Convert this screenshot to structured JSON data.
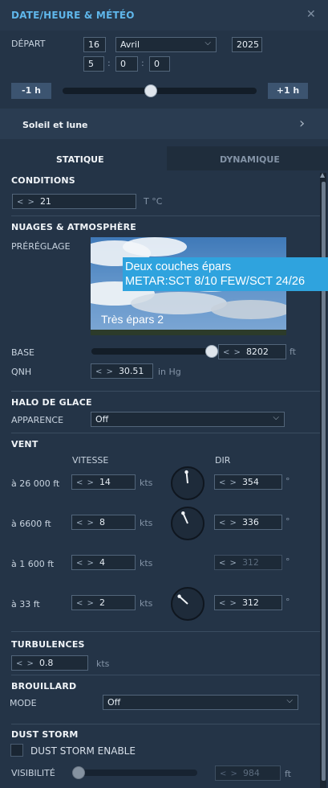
{
  "window": {
    "title": "DATE/HEURE & MÉTÉO"
  },
  "depart": {
    "label": "DÉPART",
    "day": "16",
    "month": "Avril",
    "year": "2025",
    "hour": "5",
    "minute": "0",
    "second": "0",
    "minus_hour": "-1 h",
    "plus_hour": "+1 h",
    "time_slider": 0.45
  },
  "sun_moon": {
    "label": "Soleil et lune"
  },
  "tabs": {
    "static": "STATIQUE",
    "dynamic": "DYNAMIQUE"
  },
  "conditions": {
    "title": "CONDITIONS",
    "temp": "21",
    "temp_unit": "T °C"
  },
  "clouds": {
    "title": "NUAGES & ATMOSPHÈRE",
    "preset_label": "PRÉRÉGLAGE",
    "preset_name": "Très épars 2",
    "tooltip_line1": "Deux couches épars",
    "tooltip_line2": "METAR:SCT 8/10 FEW/SCT 24/26",
    "base_label": "BASE",
    "base_value": "8202",
    "base_unit": "ft",
    "base_slider": 1.0,
    "qnh_label": "QNH",
    "qnh_value": "30.51",
    "qnh_unit": "in Hg"
  },
  "ice_halo": {
    "title": "HALO DE GLACE",
    "appearance_label": "APPARENCE",
    "appearance_value": "Off"
  },
  "wind": {
    "title": "VENT",
    "speed_header": "VITESSE",
    "dir_header": "DIR",
    "speed_unit": "kts",
    "dir_unit": "°",
    "rows": [
      {
        "alt": "à 26 000 ft",
        "speed": "14",
        "dir": "354",
        "dir_deg": 354
      },
      {
        "alt": "à 6600 ft",
        "speed": "8",
        "dir": "336",
        "dir_deg": 336
      },
      {
        "alt": "à 1 600 ft",
        "speed": "4",
        "dir": "312"
      },
      {
        "alt": "à 33 ft",
        "speed": "2",
        "dir": "312",
        "dir_deg": 312
      }
    ]
  },
  "turbulence": {
    "title": "TURBULENCES",
    "value": "0.8",
    "unit": "kts"
  },
  "fog": {
    "title": "BROUILLARD",
    "mode_label": "MODE",
    "mode_value": "Off"
  },
  "dust": {
    "title": "DUST STORM",
    "enable_label": "DUST STORM ENABLE",
    "visibility_label": "VISIBILITÉ",
    "visibility_value": "984",
    "visibility_unit": "ft",
    "visibility_slider": 0.0
  },
  "colors": {
    "accent": "#5fb6ea",
    "panel": "#243447",
    "tooltip": "#2fa3de"
  }
}
